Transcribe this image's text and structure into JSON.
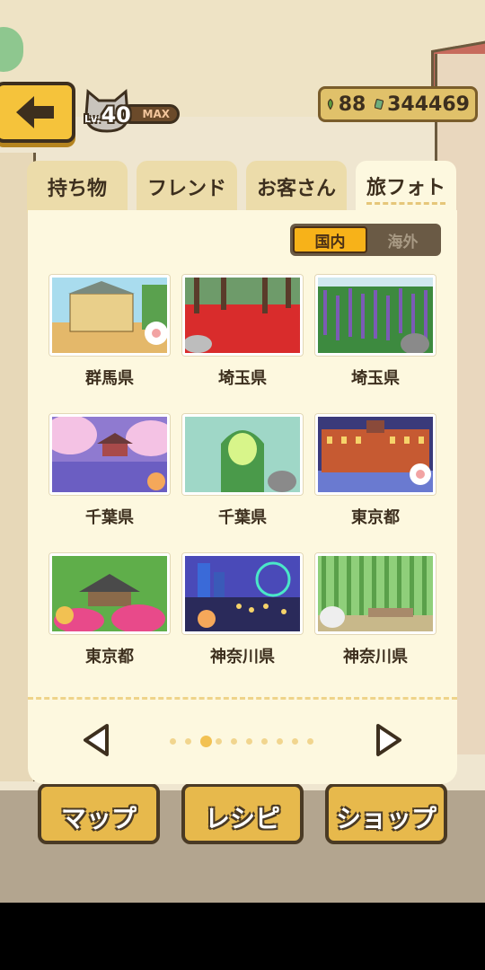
{
  "header": {
    "level_prefix": "Lv.",
    "level": "40",
    "level_status": "MAX",
    "leaves": "88",
    "money": "344469"
  },
  "tabs": [
    {
      "label": "持ち物",
      "active": false
    },
    {
      "label": "フレンド",
      "active": false
    },
    {
      "label": "お客さん",
      "active": false
    },
    {
      "label": "旅フォト",
      "active": true
    }
  ],
  "region_toggle": {
    "domestic": "国内",
    "overseas": "海外",
    "selected": "domestic"
  },
  "photos": [
    {
      "label": "群馬県",
      "scene": "mansion"
    },
    {
      "label": "埼玉県",
      "scene": "red-forest"
    },
    {
      "label": "埼玉県",
      "scene": "flower-field"
    },
    {
      "label": "千葉県",
      "scene": "sakura-pavilion"
    },
    {
      "label": "千葉県",
      "scene": "cave-light"
    },
    {
      "label": "東京都",
      "scene": "station-night"
    },
    {
      "label": "東京都",
      "scene": "azalea-pavilion"
    },
    {
      "label": "神奈川県",
      "scene": "night-wheel"
    },
    {
      "label": "神奈川県",
      "scene": "bamboo-grove"
    }
  ],
  "pagination": {
    "current": 3,
    "total": 10
  },
  "bottom_nav": {
    "map": "マップ",
    "recipe": "レシピ",
    "shop": "ショップ"
  },
  "colors": {
    "accent": "#f7b219",
    "panel": "#fdf8df",
    "text": "#3d2f1e"
  }
}
